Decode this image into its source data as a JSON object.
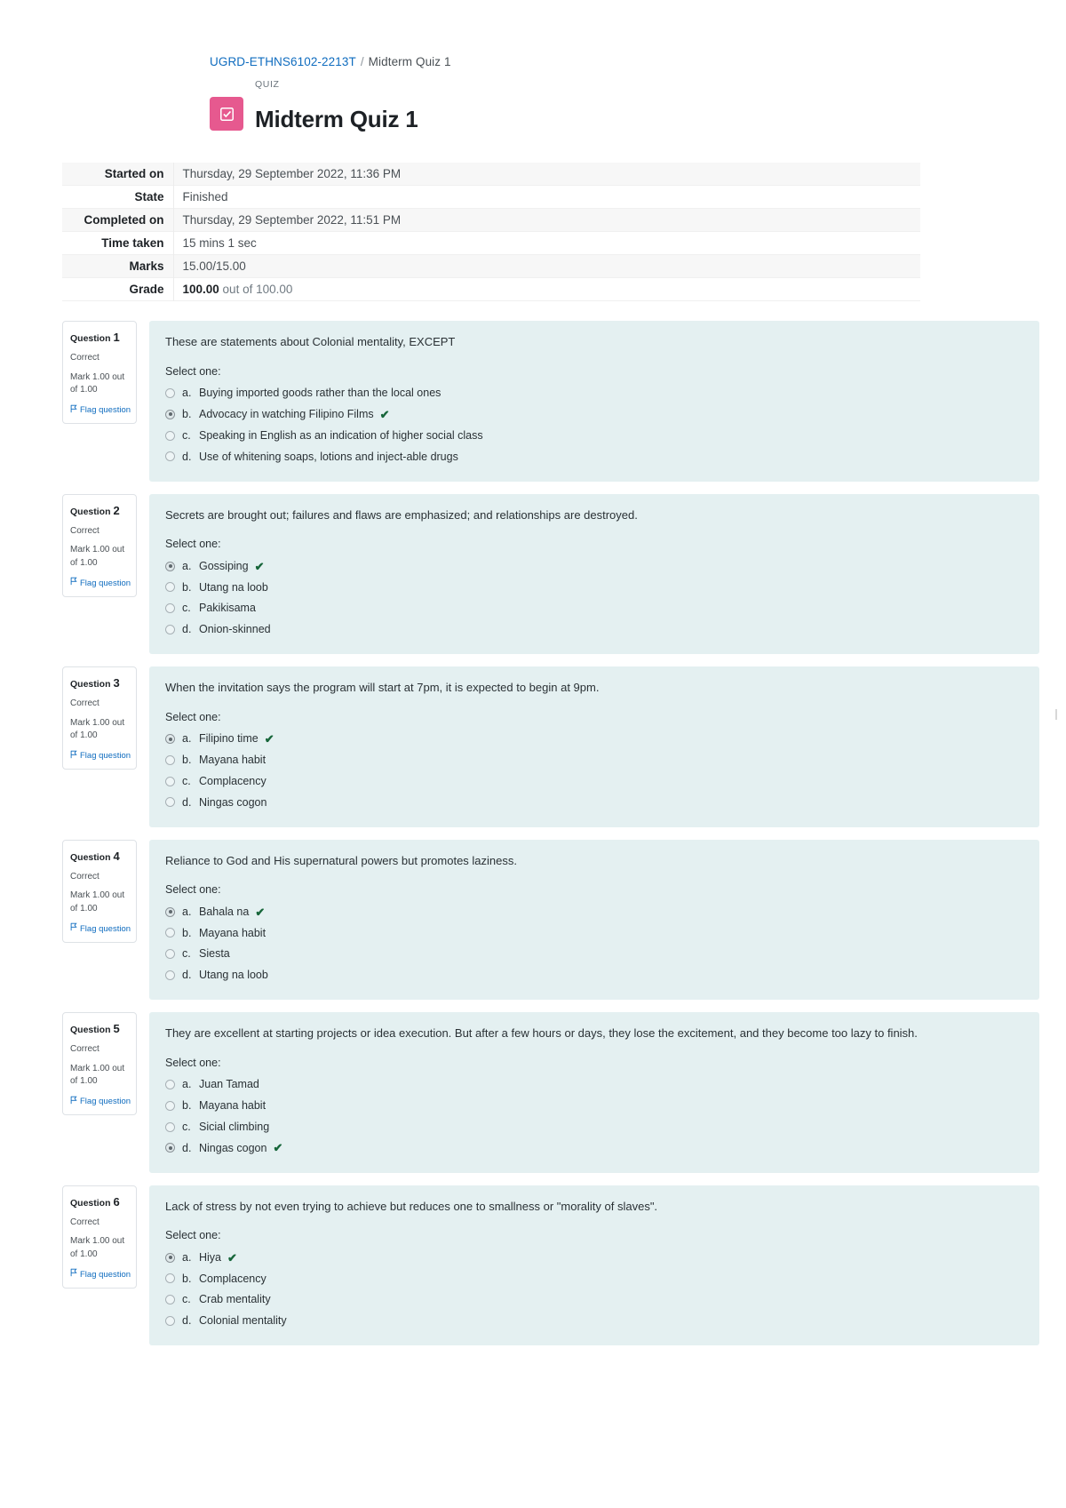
{
  "breadcrumb": {
    "course": "UGRD-ETHNS6102-2213T",
    "separator": "/",
    "current": "Midterm Quiz 1"
  },
  "header": {
    "activity_kind": "QUIZ",
    "title": "Midterm Quiz 1",
    "icon": "quiz-checkbox-icon",
    "icon_color": "#e6598f"
  },
  "attempt_info": {
    "rows": [
      {
        "label": "Started on",
        "value": "Thursday, 29 September 2022, 11:36 PM"
      },
      {
        "label": "State",
        "value": "Finished"
      },
      {
        "label": "Completed on",
        "value": "Thursday, 29 September 2022, 11:51 PM"
      },
      {
        "label": "Time taken",
        "value": "15 mins 1 sec"
      },
      {
        "label": "Marks",
        "value": "15.00/15.00"
      }
    ],
    "grade": {
      "label": "Grade",
      "value_bold": "100.00",
      "value_rest": " out of 100.00"
    }
  },
  "labels": {
    "question_word": "Question",
    "select_one": "Select one:",
    "flag_question": "Flag question",
    "correct_mark": "✔"
  },
  "questions": [
    {
      "number": "1",
      "state": "Correct",
      "mark": "Mark 1.00 out of 1.00",
      "flag": "Flag question",
      "text": "These are statements about Colonial mentality, EXCEPT",
      "select_one": "Select one:",
      "answers": [
        {
          "letter": "a.",
          "text": "Buying imported goods rather than the local ones",
          "selected": false,
          "correct": false
        },
        {
          "letter": "b.",
          "text": "Advocacy in watching Filipino Films",
          "selected": true,
          "correct": true
        },
        {
          "letter": "c.",
          "text": "Speaking in English as an indication of higher social class",
          "selected": false,
          "correct": false
        },
        {
          "letter": "d.",
          "text": "Use of whitening soaps, lotions and inject-able drugs",
          "selected": false,
          "correct": false
        }
      ]
    },
    {
      "number": "2",
      "state": "Correct",
      "mark": "Mark 1.00 out of 1.00",
      "flag": "Flag question",
      "text": "Secrets are brought out; failures and flaws are emphasized; and relationships are destroyed.",
      "select_one": "Select one:",
      "answers": [
        {
          "letter": "a.",
          "text": "Gossiping",
          "selected": true,
          "correct": true
        },
        {
          "letter": "b.",
          "text": "Utang na loob",
          "selected": false,
          "correct": false
        },
        {
          "letter": "c.",
          "text": "Pakikisama",
          "selected": false,
          "correct": false
        },
        {
          "letter": "d.",
          "text": "Onion-skinned",
          "selected": false,
          "correct": false
        }
      ]
    },
    {
      "number": "3",
      "state": "Correct",
      "mark": "Mark 1.00 out of 1.00",
      "flag": "Flag question",
      "text": "When the invitation says the program will start at 7pm, it is expected to begin at 9pm.",
      "select_one": "Select one:",
      "answers": [
        {
          "letter": "a.",
          "text": "Filipino time",
          "selected": true,
          "correct": true
        },
        {
          "letter": "b.",
          "text": "Mayana habit",
          "selected": false,
          "correct": false
        },
        {
          "letter": "c.",
          "text": "Complacency",
          "selected": false,
          "correct": false
        },
        {
          "letter": "d.",
          "text": "Ningas cogon",
          "selected": false,
          "correct": false
        }
      ]
    },
    {
      "number": "4",
      "state": "Correct",
      "mark": "Mark 1.00 out of 1.00",
      "flag": "Flag question",
      "text": "Reliance to God and His supernatural powers but promotes laziness.",
      "select_one": "Select one:",
      "answers": [
        {
          "letter": "a.",
          "text": "Bahala na",
          "selected": true,
          "correct": true
        },
        {
          "letter": "b.",
          "text": "Mayana habit",
          "selected": false,
          "correct": false
        },
        {
          "letter": "c.",
          "text": "Siesta",
          "selected": false,
          "correct": false
        },
        {
          "letter": "d.",
          "text": "Utang na loob",
          "selected": false,
          "correct": false
        }
      ]
    },
    {
      "number": "5",
      "state": "Correct",
      "mark": "Mark 1.00 out of 1.00",
      "flag": "Flag question",
      "text": "They are excellent at starting projects or idea execution. But after a few hours or days, they lose the excitement, and they become too lazy to finish.",
      "select_one": "Select one:",
      "answers": [
        {
          "letter": "a.",
          "text": "Juan Tamad",
          "selected": false,
          "correct": false
        },
        {
          "letter": "b.",
          "text": "Mayana habit",
          "selected": false,
          "correct": false
        },
        {
          "letter": "c.",
          "text": "Sicial climbing",
          "selected": false,
          "correct": false
        },
        {
          "letter": "d.",
          "text": "Ningas cogon",
          "selected": true,
          "correct": true
        }
      ]
    },
    {
      "number": "6",
      "state": "Correct",
      "mark": "Mark 1.00 out of 1.00",
      "flag": "Flag question",
      "text": "Lack of stress by not even trying to achieve but reduces one to smallness or \"morality of slaves\".",
      "select_one": "Select one:",
      "answers": [
        {
          "letter": "a.",
          "text": "Hiya",
          "selected": true,
          "correct": true
        },
        {
          "letter": "b.",
          "text": "Complacency",
          "selected": false,
          "correct": false
        },
        {
          "letter": "c.",
          "text": "Crab mentality",
          "selected": false,
          "correct": false
        },
        {
          "letter": "d.",
          "text": "Colonial mentality",
          "selected": false,
          "correct": false
        }
      ]
    }
  ]
}
